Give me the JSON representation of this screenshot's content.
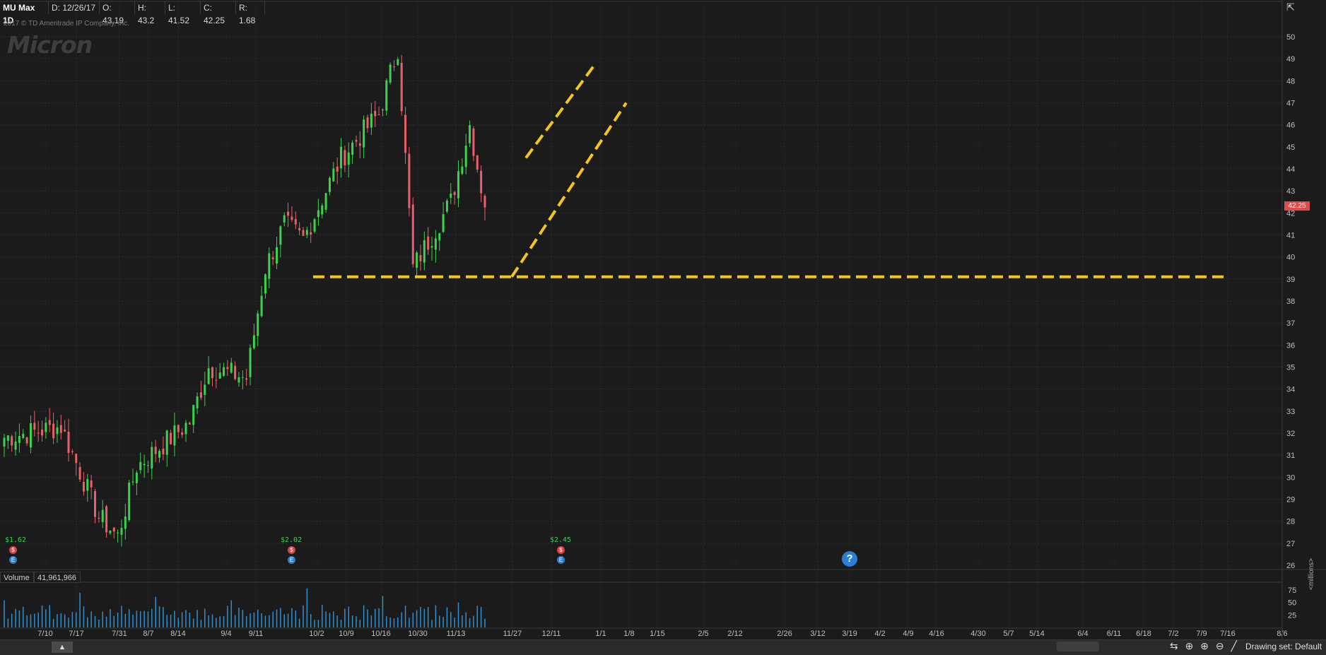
{
  "header": {
    "symbol": "MU Max 1D",
    "date": "D: 12/26/17",
    "open": "O: 43.19",
    "high": "H: 43.2",
    "low": "L: 41.52",
    "close": "C: 42.25",
    "range": "R: 1.68"
  },
  "copyright": "2017 © TD Ameritrade IP Company, Inc.",
  "logo_text": "Micron",
  "last_price_label": "42.25",
  "volume_panel": {
    "label": "Volume",
    "value": "41,961,966",
    "unit_label": "<millions>"
  },
  "dividends": [
    {
      "label": "$1.62",
      "x_index": 0
    },
    {
      "label": "$2.02",
      "x_index": 82
    },
    {
      "label": "$2.45",
      "x_index": 161
    }
  ],
  "help_icon": "?",
  "drawing_set": "Drawing set: Default",
  "colors": {
    "up": "#3cd14e",
    "down": "#e8606a",
    "annotation": "#f5c518",
    "volume": "#2f8fd0",
    "background": "#1b1b1b"
  },
  "chart_data": {
    "type": "candlestick",
    "title": "",
    "x_axis_ticks": [
      "7/10",
      "7/17",
      "7/31",
      "8/7",
      "8/14",
      "9/4",
      "9/11",
      "10/2",
      "10/9",
      "10/16",
      "10/30",
      "11/13",
      "11/27",
      "12/11",
      "1/1",
      "1/8",
      "1/15",
      "2/5",
      "2/12",
      "2/26",
      "3/12",
      "3/19",
      "4/2",
      "4/9",
      "4/16",
      "4/30",
      "5/7",
      "5/14",
      "6/4",
      "6/11",
      "6/18",
      "7/2",
      "7/9",
      "7/16",
      "8/6"
    ],
    "y_ticks": [
      26,
      27,
      28,
      29,
      30,
      31,
      32,
      33,
      34,
      35,
      36,
      37,
      38,
      39,
      40,
      41,
      42,
      43,
      44,
      45,
      46,
      47,
      48,
      49,
      50
    ],
    "ylim": [
      26,
      50.5
    ],
    "volume_ticks": [
      25,
      50,
      75
    ],
    "grid": true,
    "start_x": "2017-06-26",
    "end_x": "2017-12-26",
    "start_close": 31.8,
    "key_points": [
      {
        "date": "7/17",
        "close": 32.3
      },
      {
        "date": "7/31",
        "close": 28.2
      },
      {
        "date": "8/7",
        "close": 27.3
      },
      {
        "date": "8/14",
        "close": 30.5
      },
      {
        "date": "9/4",
        "close": 32.5
      },
      {
        "date": "9/11",
        "close": 35.0
      },
      {
        "date": "9/25",
        "close": 34.5
      },
      {
        "date": "10/2",
        "close": 39.5
      },
      {
        "date": "10/9",
        "close": 41.5
      },
      {
        "date": "10/16",
        "close": 40.8
      },
      {
        "date": "10/30",
        "close": 44.5
      },
      {
        "date": "11/13",
        "close": 46.5
      },
      {
        "date": "11/20",
        "close": 49.5
      },
      {
        "date": "11/27",
        "close": 39.5
      },
      {
        "date": "12/11",
        "close": 42.5
      },
      {
        "date": "12/18",
        "close": 46.0
      },
      {
        "date": "12/26",
        "close": 42.25
      }
    ],
    "annotations": [
      {
        "type": "horizontal_line",
        "price": 39.1,
        "from": "10/2",
        "to": "7/16",
        "style": "dashed"
      },
      {
        "type": "trend_line",
        "from": {
          "date": "11/27",
          "price": 39.1
        },
        "to": {
          "date": "1/1",
          "price": 47.0
        },
        "style": "dashed"
      },
      {
        "type": "trend_line",
        "from": {
          "date": "12/4",
          "price": 44.5
        },
        "to": {
          "date": "12/26",
          "price": 48.8
        },
        "style": "dashed"
      }
    ]
  }
}
